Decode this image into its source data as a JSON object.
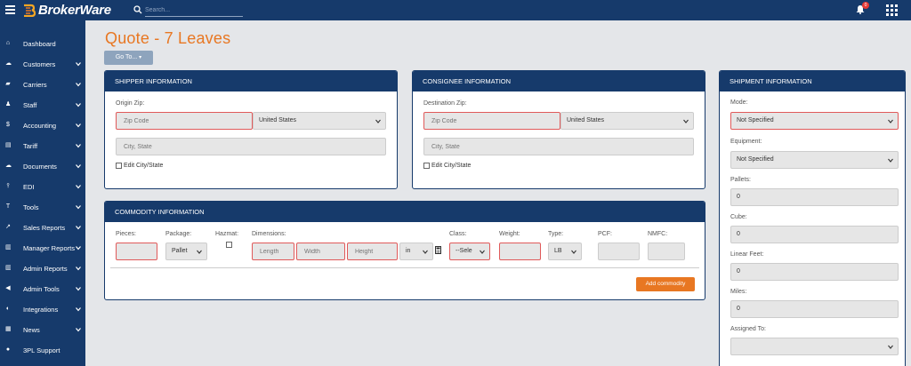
{
  "app": {
    "brand": "BrokerWare"
  },
  "topbar": {
    "search_placeholder": "Search...",
    "notifications_count": "0"
  },
  "sidebar": {
    "items": [
      {
        "label": "Dashboard",
        "icon": "home-icon",
        "chevron": false
      },
      {
        "label": "Customers",
        "icon": "cloud-icon",
        "chevron": true
      },
      {
        "label": "Carriers",
        "icon": "truck-icon",
        "chevron": true
      },
      {
        "label": "Staff",
        "icon": "users-icon",
        "chevron": true
      },
      {
        "label": "Accounting",
        "icon": "dollar-icon",
        "chevron": true
      },
      {
        "label": "Tariff",
        "icon": "document-icon",
        "chevron": true
      },
      {
        "label": "Documents",
        "icon": "cloud-upload-icon",
        "chevron": true
      },
      {
        "label": "EDI",
        "icon": "usb-icon",
        "chevron": true
      },
      {
        "label": "Tools",
        "icon": "text-icon",
        "chevron": true
      },
      {
        "label": "Sales Reports",
        "icon": "line-chart-icon",
        "chevron": true
      },
      {
        "label": "Manager Reports",
        "icon": "bar-chart-icon",
        "chevron": true
      },
      {
        "label": "Admin Reports",
        "icon": "bar-chart-icon",
        "chevron": true
      },
      {
        "label": "Admin Tools",
        "icon": "megaphone-icon",
        "chevron": true
      },
      {
        "label": "Integrations",
        "icon": "toggle-icon",
        "chevron": true
      },
      {
        "label": "News",
        "icon": "newspaper-icon",
        "chevron": true
      },
      {
        "label": "3PL Support",
        "icon": "globe-icon",
        "chevron": false
      }
    ]
  },
  "page": {
    "title": "Quote - 7 Leaves",
    "goto_label": "Go To..."
  },
  "shipper": {
    "header": "SHIPPER INFORMATION",
    "origin_zip_label": "Origin Zip:",
    "zip_placeholder": "Zip Code",
    "country": "United States",
    "city_state_placeholder": "City, State",
    "edit_city_state": "Edit City/State"
  },
  "consignee": {
    "header": "CONSIGNEE INFORMATION",
    "destination_zip_label": "Destination Zip:",
    "zip_placeholder": "Zip Code",
    "country": "United States",
    "city_state_placeholder": "City, State",
    "edit_city_state": "Edit City/State"
  },
  "commodity": {
    "header": "COMMODITY INFORMATION",
    "pieces_label": "Pieces:",
    "package_label": "Package:",
    "package_value": "Pallet",
    "hazmat_label": "Hazmat:",
    "dimensions_label": "Dimensions:",
    "length_placeholder": "Length",
    "width_placeholder": "Width",
    "height_placeholder": "Height",
    "unit_value": "in",
    "class_label": "Class:",
    "class_value": "--Sele",
    "weight_label": "Weight:",
    "type_label": "Type:",
    "type_value": "LB",
    "pcf_label": "PCF:",
    "nmfc_label": "NMFC:",
    "add_button": "Add commodity"
  },
  "shipment": {
    "header": "SHIPMENT INFORMATION",
    "mode_label": "Mode:",
    "mode_value": "Not Specified",
    "equipment_label": "Equipment:",
    "equipment_value": "Not Specified",
    "pallets_label": "Pallets:",
    "pallets_value": "0",
    "cube_label": "Cube:",
    "cube_value": "0",
    "linear_feet_label": "Linear Feet:",
    "linear_feet_value": "0",
    "miles_label": "Miles:",
    "miles_value": "0",
    "assigned_to_label": "Assigned To:",
    "assigned_to_value": ""
  },
  "colors": {
    "navy": "#163a6b",
    "orange": "#e87722",
    "error": "#e05a5a"
  }
}
